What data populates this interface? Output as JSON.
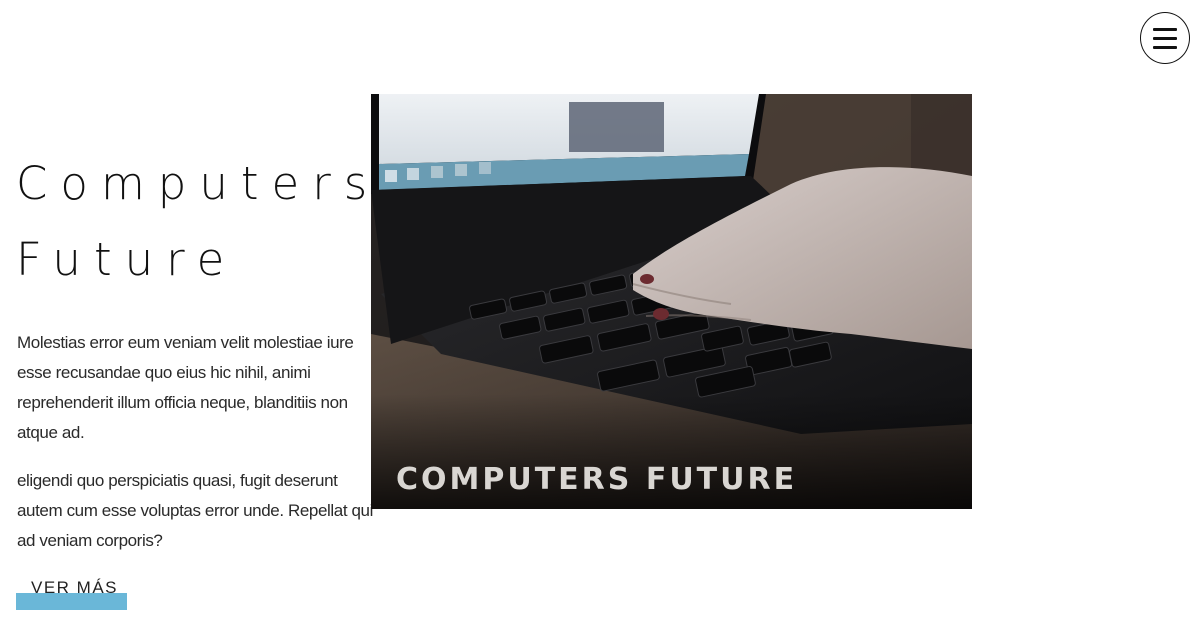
{
  "header": {
    "menu_icon": "hamburger-menu-icon"
  },
  "hero": {
    "title_line1": "Computers",
    "title_line2": "Future",
    "paragraphs": [
      "Molestias error eum veniam velit molestiae iure esse recusandae quo eius hic nihil, animi reprehenderit illum officia neque, blanditiis non atque ad.",
      "eligendi quo perspiciatis quasi, fugit deserunt autem cum esse voluptas error unde. Repellat qui ad veniam corporis?"
    ],
    "cta_label": "VER MÁS",
    "image_caption": "COMPUTERS FUTURE"
  },
  "colors": {
    "accent": "#6ab7d8",
    "text": "#222222",
    "background": "#ffffff"
  }
}
